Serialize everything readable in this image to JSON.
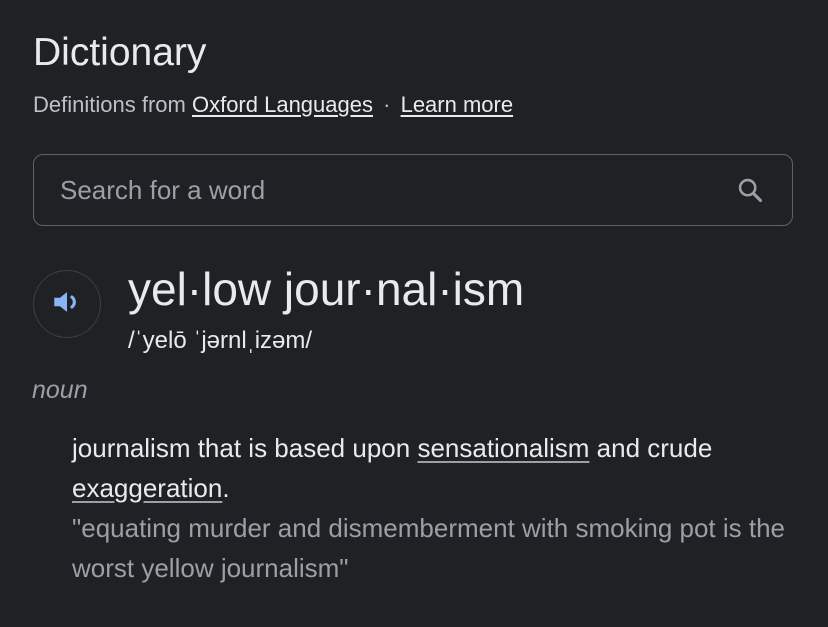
{
  "header": {
    "title": "Dictionary",
    "source_prefix": "Definitions from",
    "source_link": "Oxford Languages",
    "separator": "·",
    "learn_more": "Learn more"
  },
  "search": {
    "placeholder": "Search for a word",
    "value": "",
    "icon": "search-icon"
  },
  "entry": {
    "audio_icon": "speaker-icon",
    "word": "yel·low jour·nal·ism",
    "phonetic": "/ˈyelō ˈjərnlˌizəm/",
    "part_of_speech": "noun",
    "definition": {
      "part1": "journalism that is based upon ",
      "link1": "sensationalism",
      "part2": " and crude ",
      "link2": "exaggeration",
      "part3": "."
    },
    "example": "\"equating murder and dismemberment with smoking pot is the worst yellow journalism\""
  },
  "colors": {
    "background": "#202124",
    "text_primary": "#e8eaed",
    "text_secondary": "#9aa0a6",
    "border": "#5f6368",
    "audio_accent": "#8ab4f8"
  }
}
